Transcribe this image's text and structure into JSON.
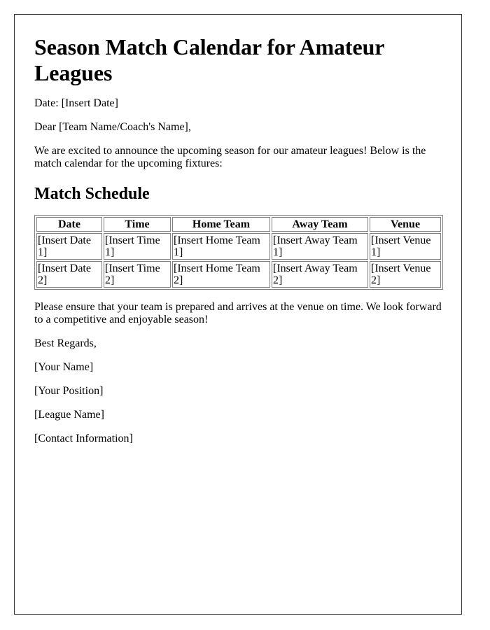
{
  "document": {
    "title": "Season Match Calendar for Amateur Leagues",
    "date_line": "Date: [Insert Date]",
    "salutation": "Dear [Team Name/Coach's Name],",
    "intro": "We are excited to announce the upcoming season for our amateur leagues! Below is the match calendar for the upcoming fixtures:",
    "schedule_heading": "Match Schedule",
    "table": {
      "headers": [
        "Date",
        "Time",
        "Home Team",
        "Away Team",
        "Venue"
      ],
      "rows": [
        [
          "[Insert Date 1]",
          "[Insert Time 1]",
          "[Insert Home Team 1]",
          "[Insert Away Team 1]",
          "[Insert Venue 1]"
        ],
        [
          "[Insert Date 2]",
          "[Insert Time 2]",
          "[Insert Home Team 2]",
          "[Insert Away Team 2]",
          "[Insert Venue 2]"
        ]
      ]
    },
    "closing_note": "Please ensure that your team is prepared and arrives at the venue on time. We look forward to a competitive and enjoyable season!",
    "sign_off": "Best Regards,",
    "your_name": "[Your Name]",
    "your_position": "[Your Position]",
    "league_name": "[League Name]",
    "contact_info": "[Contact Information]"
  }
}
